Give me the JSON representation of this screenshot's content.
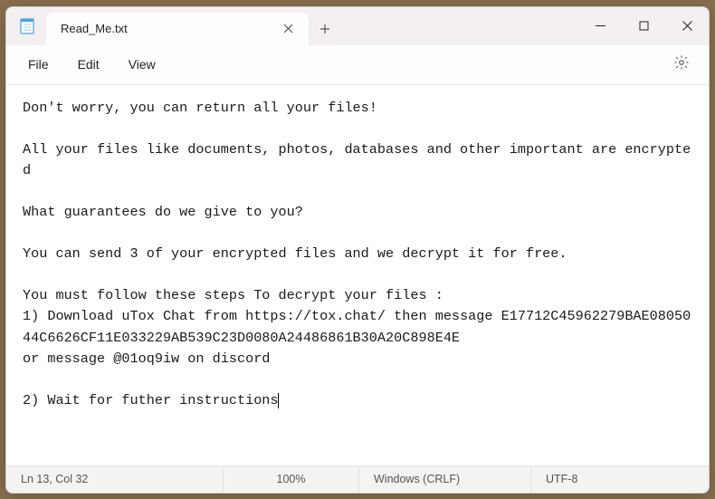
{
  "tab": {
    "title": "Read_Me.txt"
  },
  "menu": {
    "file": "File",
    "edit": "Edit",
    "view": "View"
  },
  "content": {
    "text": "Don't worry, you can return all your files!\n\nAll your files like documents, photos, databases and other important are encrypted\n\nWhat guarantees do we give to you?\n\nYou can send 3 of your encrypted files and we decrypt it for free.\n\nYou must follow these steps To decrypt your files :\n1) Download uTox Chat from https://tox.chat/ then message E17712C45962279BAE0805044C6626CF11E033229AB539C23D0080A24486861B30A20C898E4E\nor message @01oq9iw on discord\n\n2) Wait for futher instructions"
  },
  "status": {
    "position": "Ln 13, Col 32",
    "zoom": "100%",
    "eol": "Windows (CRLF)",
    "encoding": "UTF-8"
  }
}
